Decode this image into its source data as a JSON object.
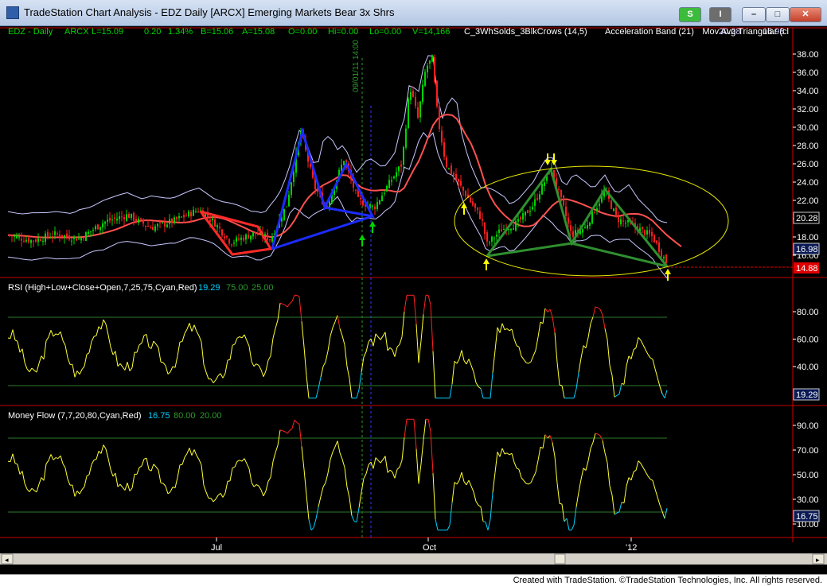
{
  "window": {
    "title": "TradeStation Chart Analysis - EDZ Daily [ARCX] Emerging Markets Bear 3x Shrs",
    "buttons": {
      "green": "S",
      "gray": "I",
      "minimize": "–",
      "maximize": "□",
      "close": "✕"
    }
  },
  "price_header": {
    "symbol": "EDZ - Daily",
    "exchange": "ARCX",
    "last": "L=15.09",
    "change": "0.20",
    "pct": "1.34%",
    "bid": "B=15.06",
    "ask": "A=15.08",
    "open": "O=0.00",
    "high": "Hi=0.00",
    "low": "Lo=0.00",
    "volume": "V=14,166",
    "indicator1": "C_3WhSolds_3BlkCrows (14,5)",
    "indicator2": "Acceleration Band (21)",
    "indicator2_value": "20.28",
    "indicator3_value": "16.98",
    "indicator3": "Mov Avg Triangular (cl"
  },
  "cursor_date_label": "09/01/11 14:00",
  "rsi_header": {
    "label": "RSI (High+Low+Close+Open,7,25,75,Cyan,Red)",
    "value": "19.29",
    "ob": "75.00",
    "os": "25.00"
  },
  "mf_header": {
    "label": "Money Flow (7,7,20,80,Cyan,Red)",
    "value": "16.75",
    "ob": "80.00",
    "os": "20.00"
  },
  "price_axis": {
    "ticks": [
      "38.00",
      "36.00",
      "34.00",
      "32.00",
      "30.00",
      "28.00",
      "26.00",
      "24.00",
      "22.00",
      "20.00",
      "18.00",
      "16.00"
    ]
  },
  "price_tags": {
    "upper_band": "20.28",
    "moving_avg": "16.98",
    "last": "14.88"
  },
  "rsi_axis": {
    "ticks": [
      "80.00",
      "60.00",
      "40.00"
    ],
    "current": "19.29"
  },
  "mf_axis": {
    "ticks": [
      "90.00",
      "70.00",
      "50.00",
      "30.00",
      "10.00"
    ],
    "current": "16.75"
  },
  "time_axis": {
    "labels": [
      "Jul",
      "Oct",
      "'12"
    ]
  },
  "colors": {
    "background": "#000000",
    "up_candle": "#00d400",
    "down_candle": "#ff1f1f",
    "band": "#c8c8ff",
    "moving_average": "#ff5050",
    "pattern_red": "#ff2a2a",
    "pattern_blue": "#1c2bff",
    "pattern_green": "#2f8f2f",
    "ellipse": "#e8e800",
    "oscillator": "#ffff33",
    "overbought": "#ff2020",
    "oversold": "#00d0ff",
    "guide_lines": "#2c7a2c"
  },
  "credit": "Created with TradeStation. ©TradeStation Technologies, Inc. All rights reserved."
}
